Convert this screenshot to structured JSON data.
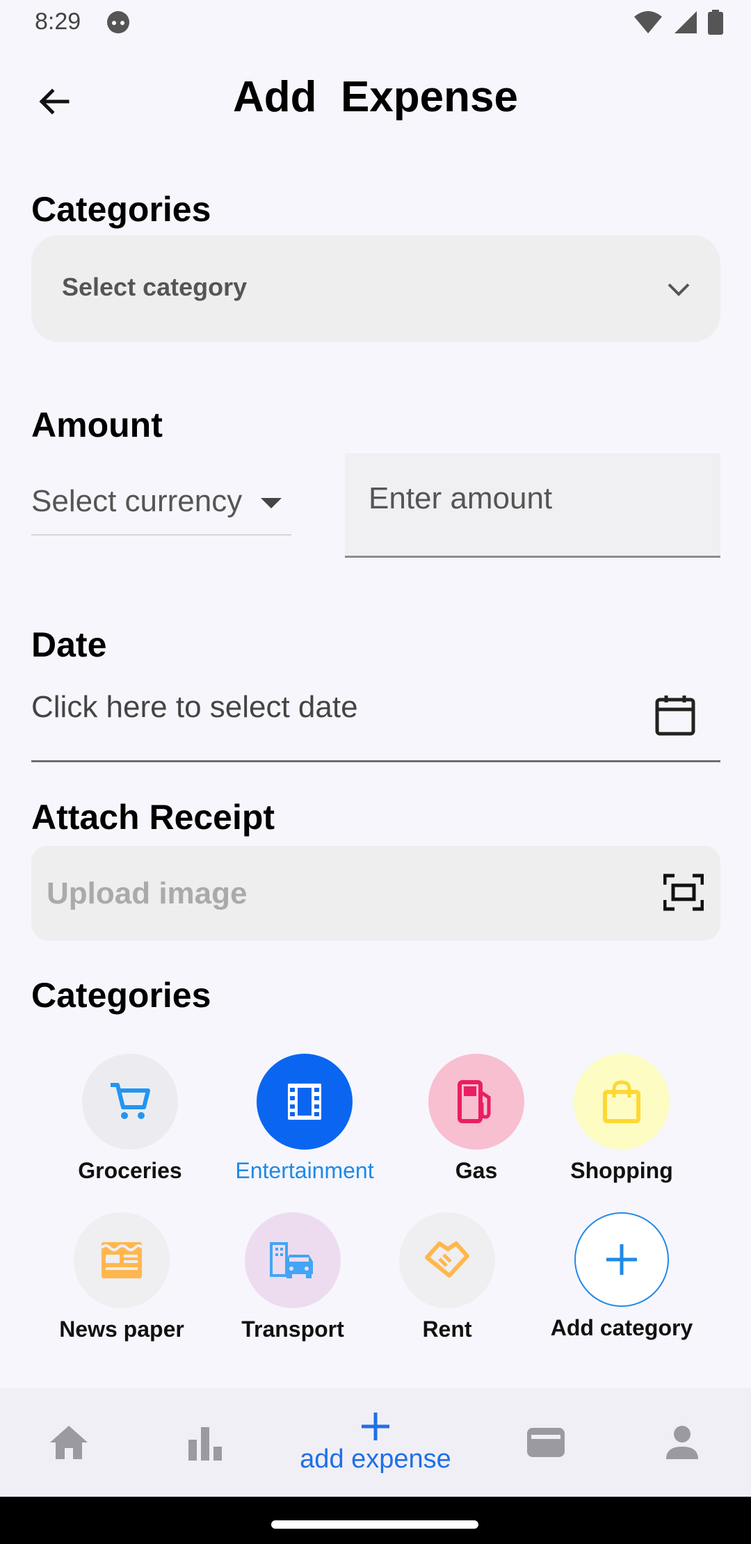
{
  "status_bar": {
    "time": "8:29"
  },
  "header": {
    "title": "Add  Expense"
  },
  "categories_section": {
    "title": "Categories",
    "select_label": "Select category"
  },
  "amount_section": {
    "title": "Amount",
    "currency_label": "Select currency",
    "amount_placeholder": "Enter amount"
  },
  "date_section": {
    "title": "Date",
    "placeholder": "Click here to select date"
  },
  "receipt_section": {
    "title": "Attach Receipt",
    "placeholder": "Upload image"
  },
  "category_grid": {
    "title": "Categories",
    "items": [
      {
        "label": "Groceries",
        "icon": "cart-icon",
        "bg": "#ececf0",
        "fg": "#2196f3"
      },
      {
        "label": "Entertainment",
        "icon": "film-icon",
        "bg": "#0a66f0",
        "fg": "#ffffff",
        "selected": true
      },
      {
        "label": "Gas",
        "icon": "fuel-icon",
        "bg": "#f7bfd0",
        "fg": "#e91e63"
      },
      {
        "label": "Shopping",
        "icon": "shopping-bag-icon",
        "bg": "#fdfcc2",
        "fg": "#fdd835"
      },
      {
        "label": "News paper",
        "icon": "newspaper-icon",
        "bg": "#efeef0",
        "fg": "#ffb74d"
      },
      {
        "label": "Transport",
        "icon": "transport-icon",
        "bg": "#eddcf0",
        "fg": "#42a5f5"
      },
      {
        "label": "Rent",
        "icon": "handshake-icon",
        "bg": "#efeef0",
        "fg": "#ffb74d"
      },
      {
        "label": "Add category",
        "icon": "plus-icon",
        "bg": "#ffffff",
        "fg": "#1f8ae8"
      }
    ]
  },
  "bottom_nav": {
    "active_label": "add expense"
  },
  "colors": {
    "accent": "#1f6fe8",
    "selected_category": "#0a66f0"
  }
}
